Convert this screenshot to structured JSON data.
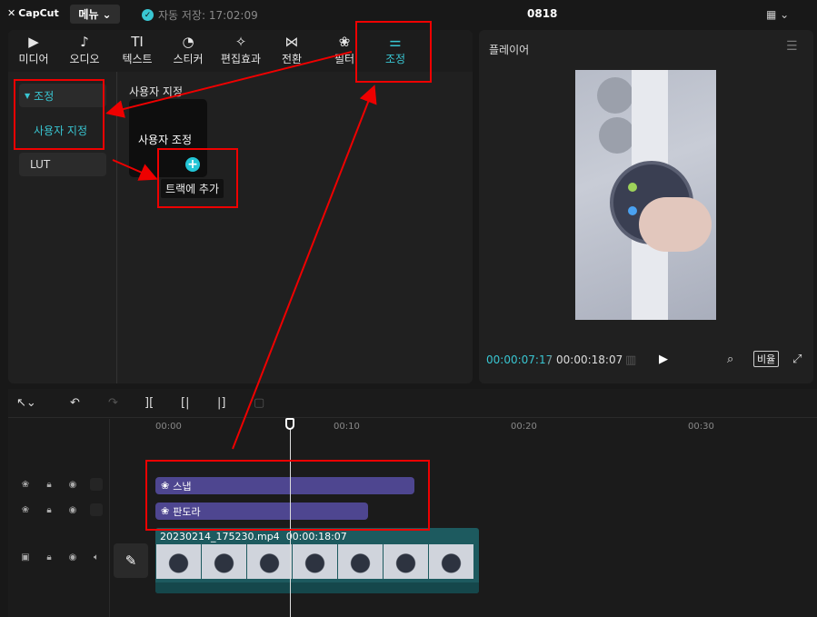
{
  "app": {
    "logo_text": "CapCut",
    "menu_label": "메뉴",
    "autosave_text": "자동 저장: 17:02:09",
    "project_name": "0818"
  },
  "tabs": [
    {
      "label": "미디어",
      "icon": "media-icon"
    },
    {
      "label": "오디오",
      "icon": "audio-icon"
    },
    {
      "label": "텍스트",
      "icon": "text-icon"
    },
    {
      "label": "스티커",
      "icon": "sticker-icon"
    },
    {
      "label": "편집효과",
      "icon": "effects-icon"
    },
    {
      "label": "전환",
      "icon": "transition-icon"
    },
    {
      "label": "필터",
      "icon": "filter-icon"
    },
    {
      "label": "조정",
      "icon": "adjust-icon",
      "active": true
    }
  ],
  "subnav": {
    "group_label": "조정",
    "custom_label": "사용자 지정",
    "lut_label": "LUT"
  },
  "content": {
    "section_label": "사용자 지정",
    "card_title": "사용자 조정",
    "tooltip": "트랙에 추가"
  },
  "player": {
    "title": "플레이어",
    "current_time": "00:00:07:17",
    "total_time": "00:00:18:07",
    "ratio_label": "비율"
  },
  "timeline": {
    "ticks": [
      "00:00",
      "00:10",
      "00:20",
      "00:30"
    ],
    "effect_clips": [
      {
        "label": "스냅"
      },
      {
        "label": "판도라"
      }
    ],
    "video_clip": {
      "filename": "20230214_175230.mp4",
      "duration": "00:00:18:07"
    }
  },
  "colors": {
    "accent": "#39c6d2",
    "effect_clip": "#4e4690",
    "video_clip": "#1d5a5f",
    "annotation": "#e00000"
  }
}
